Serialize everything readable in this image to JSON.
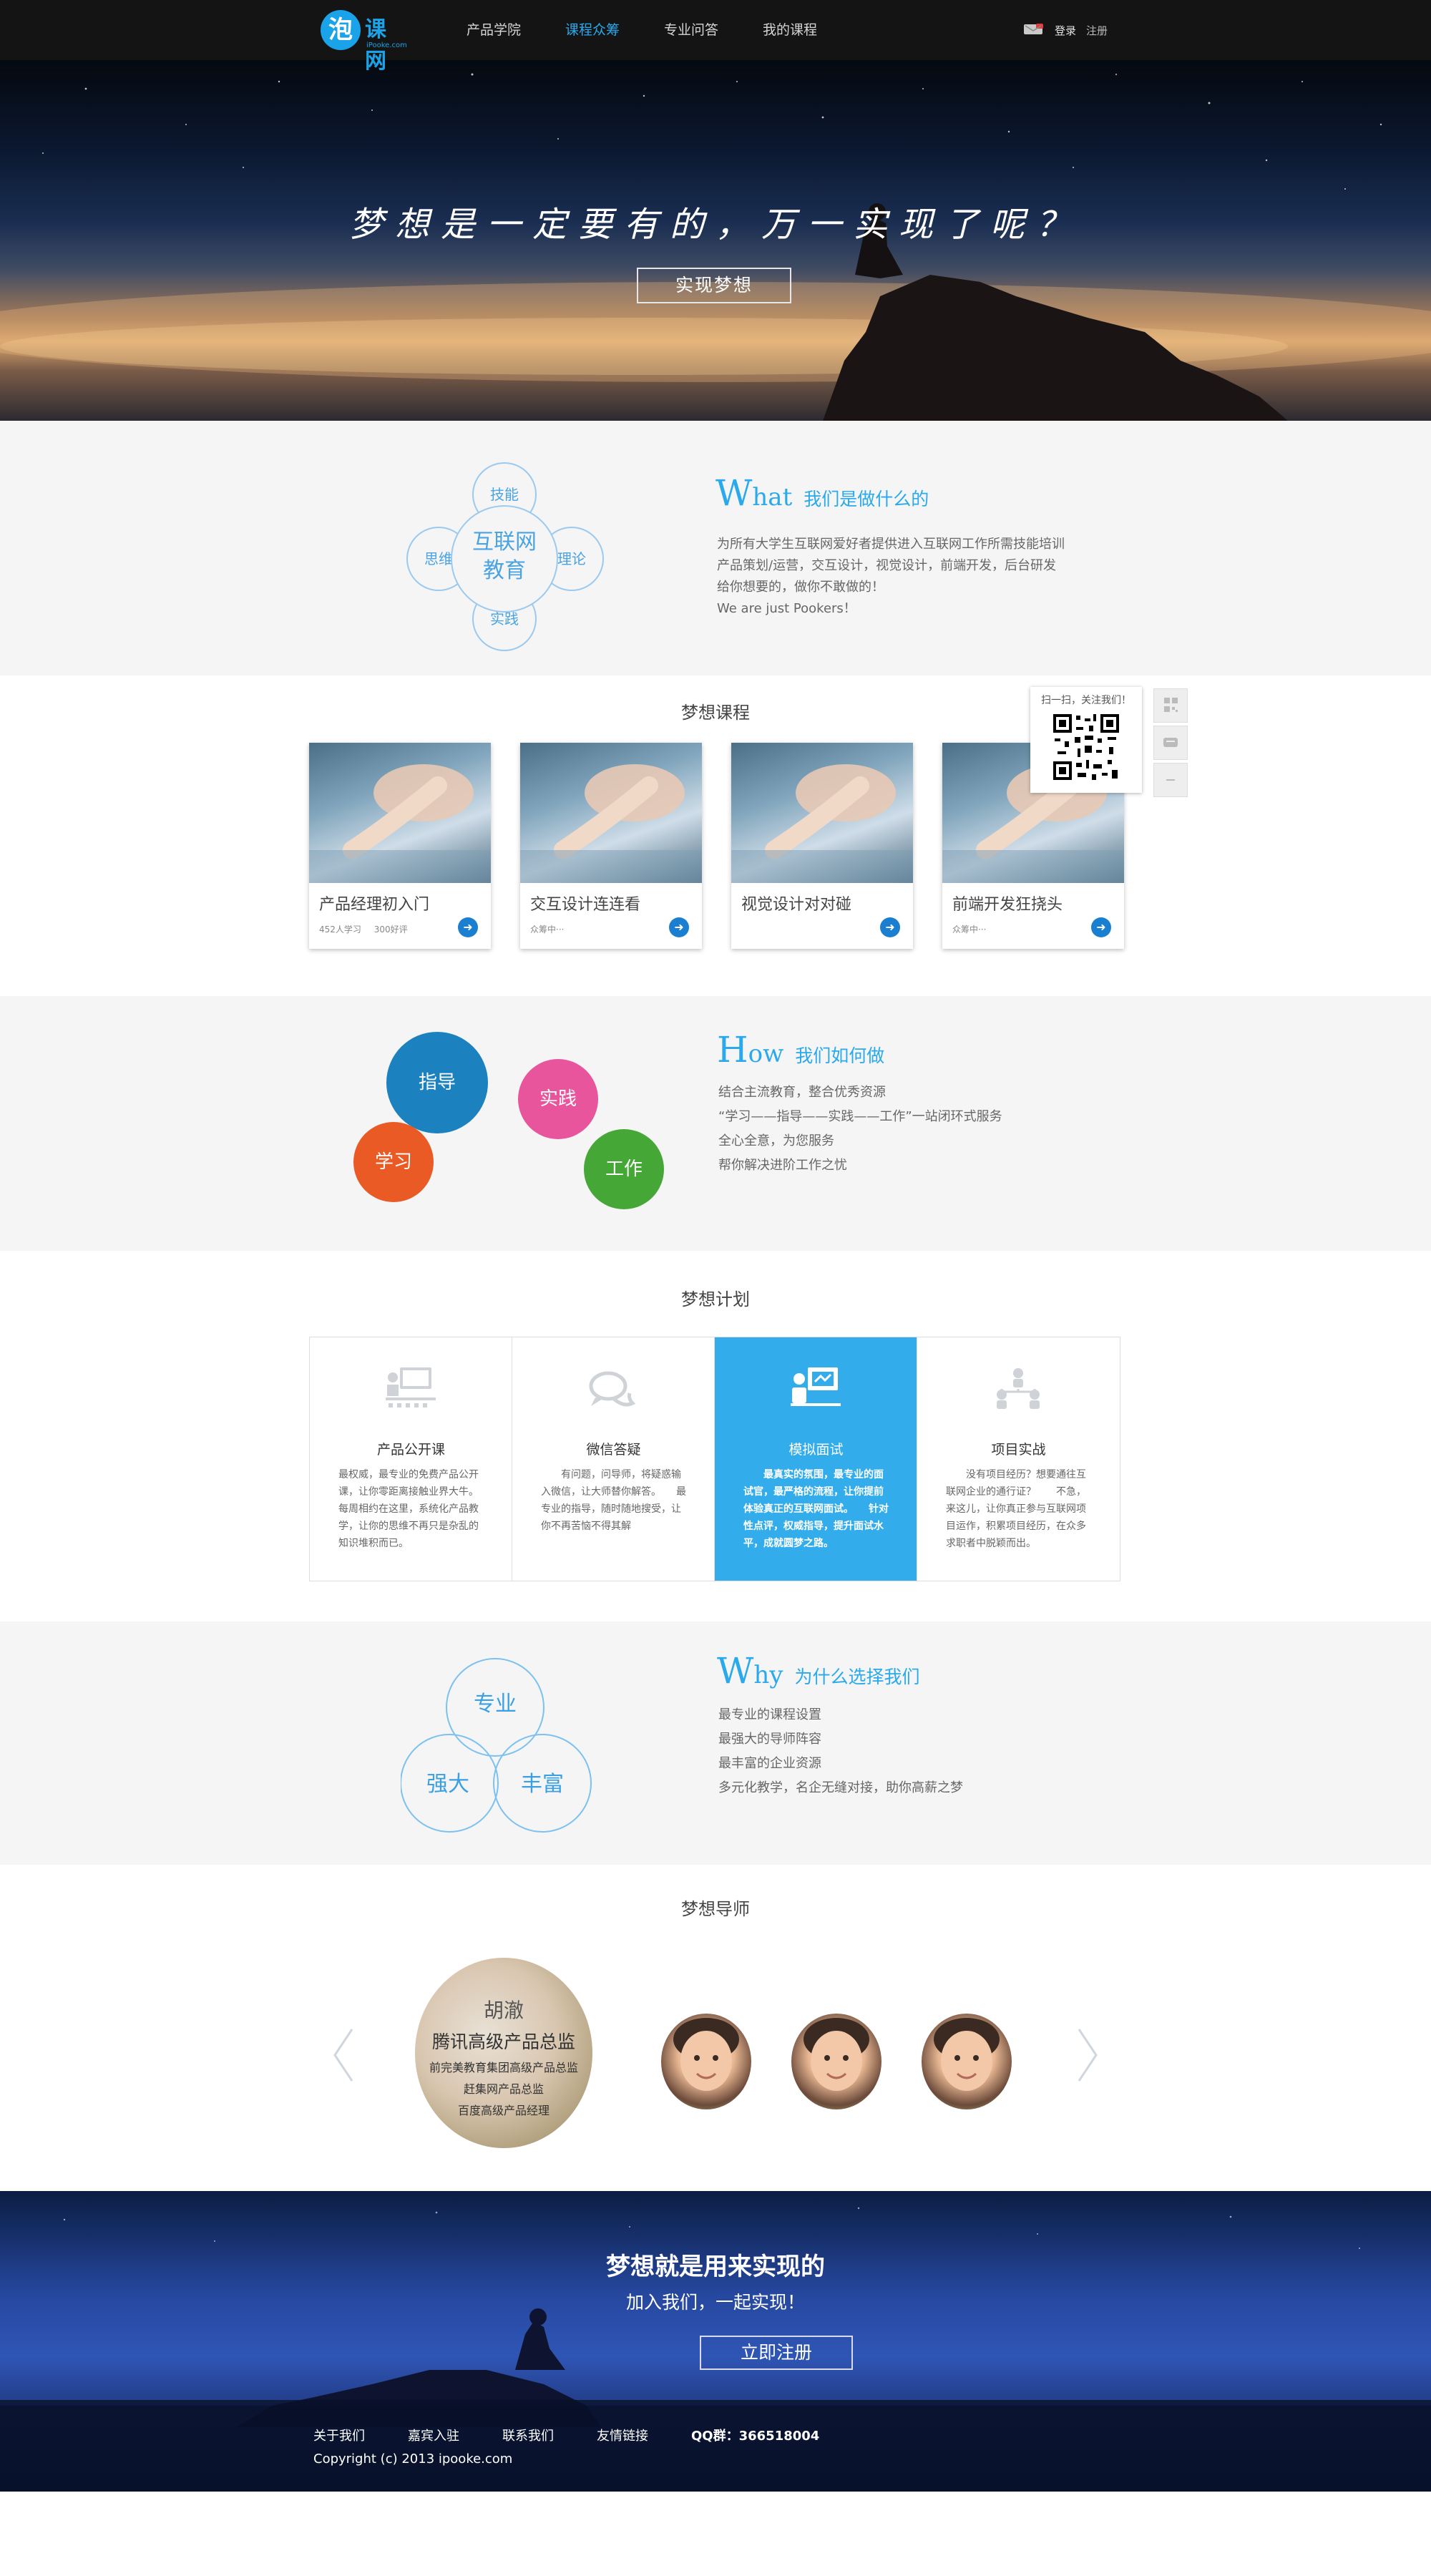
{
  "header": {
    "logo_char": "泡",
    "logo_text": "课网",
    "logo_sub": "iPooke.com",
    "nav": [
      {
        "label": "产品学院"
      },
      {
        "label": "课程众筹"
      },
      {
        "label": "专业问答"
      },
      {
        "label": "我的课程"
      }
    ],
    "active_nav": "课程众筹",
    "login": "登录",
    "register": "注册"
  },
  "hero": {
    "title": "梦想是一定要有的，万一实现了呢？",
    "button": "实现梦想"
  },
  "what": {
    "circles": {
      "center": [
        "互联网",
        "教育"
      ],
      "top": "技能",
      "left": "思维",
      "right": "理论",
      "bottom": "实践"
    },
    "letter": "W",
    "rest": "hat",
    "heading_zh": "我们是做什么的",
    "lines": [
      "为所有大学生互联网爱好者提供进入互联网工作所需技能培训",
      "产品策划/运营，交互设计，视觉设计，前端开发，后台研发",
      "给你想要的，做你不敢做的！",
      "We are just Pookers！"
    ]
  },
  "courses": {
    "heading": "梦想课程",
    "items": [
      {
        "title": "产品经理初入门",
        "meta": "452人学习 300好评"
      },
      {
        "title": "交互设计连连看",
        "meta": "众筹中···"
      },
      {
        "title": "视觉设计对对碰",
        "meta": ""
      },
      {
        "title": "前端开发狂挠头",
        "meta": "众筹中···"
      }
    ],
    "arrow": "➜"
  },
  "float": {
    "qr_caption": "扫一扫，关注我们！"
  },
  "how": {
    "dots": {
      "guide": "指导",
      "practice": "实践",
      "study": "学习",
      "work": "工作"
    },
    "colors": {
      "guide": "#1b82bf",
      "practice": "#e8559c",
      "study": "#ea5a24",
      "work": "#45a735"
    },
    "letter": "H",
    "rest": "ow",
    "heading_zh": "我们如何做",
    "lines": [
      "结合主流教育，整合优秀资源",
      "“学习——指导——实践——工作”一站闭环式服务",
      "全心全意，为您服务",
      "帮你解决进阶工作之忧"
    ]
  },
  "plan": {
    "heading": "梦想计划",
    "items": [
      {
        "title": "产品公开课",
        "text": "最权威，最专业的免费产品公开课，让你零距离接触业界大牛。　　每周相约在这里，系统化产品教学，让你的思维不再只是杂乱的知识堆积而已。"
      },
      {
        "title": "微信答疑",
        "text": "　　有问题，问导师，将疑惑输入微信，让大师替你解答。　　最专业的指导，随时随地搜受，让你不再苦恼不得其解"
      },
      {
        "title": "模拟面试",
        "text": "　　最真实的氛围，最专业的面试官，最严格的流程，让你提前体验真正的互联网面试。　　针对性点评，权威指导，提升面试水平，成就圆梦之路。"
      },
      {
        "title": "项目实战",
        "text": "　　没有项目经历？想要通往互联网企业的通行证？　　不急，来这儿，让你真正参与互联网项目运作，积累项目经历，在众多求职者中脱颖而出。"
      }
    ]
  },
  "why": {
    "circles": {
      "top": "专业",
      "left": "强大",
      "right": "丰富"
    },
    "letter": "W",
    "rest": "hy",
    "heading_zh": "为什么选择我们",
    "lines": [
      "最专业的课程设置",
      "最强大的导师阵容",
      "最丰富的企业资源",
      "多元化教学，名企无缝对接，助你高薪之梦"
    ]
  },
  "mentors": {
    "heading": "梦想导师",
    "featured": {
      "name": "胡澈",
      "title": "腾讯高级产品总监",
      "lines": [
        "前完美教育集团高级产品总监",
        "赶集网产品总监",
        "百度高级产品经理"
      ]
    },
    "prev": "‹",
    "next": "›"
  },
  "footer": {
    "title": "梦想就是用来实现的",
    "subtitle": "加入我们，一起实现！",
    "button": "立即注册",
    "links": [
      "关于我们",
      "嘉宾入驻",
      "联系我们",
      "友情链接"
    ],
    "qq": "QQ群：366518004",
    "copyright": "Copyright (c) 2013 ipooke.com"
  }
}
